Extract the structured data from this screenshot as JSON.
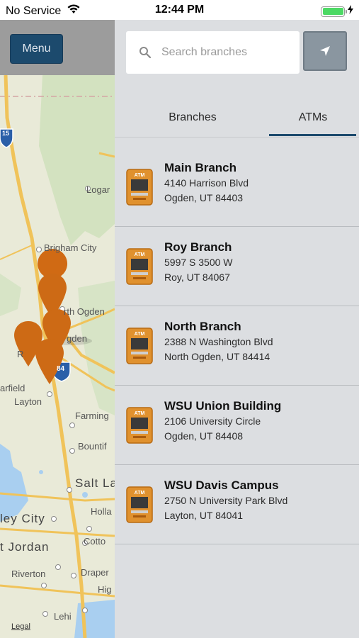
{
  "status_bar": {
    "carrier": "No Service",
    "time": "12:44 PM"
  },
  "map": {
    "menu_label": "Menu",
    "legal_label": "Legal",
    "labels": [
      "Logar",
      "Brigham City",
      "rth Ogden",
      "gden",
      "R",
      "arfield",
      "Layton",
      "Farming",
      "Bountif",
      "Salt La",
      "Holla",
      "ley City",
      "t Jordan",
      "Cotto",
      "Riverton",
      "Draper",
      "Hig",
      "Lehi"
    ],
    "highway_shields": [
      "15",
      "84"
    ],
    "pin_color": "#d06a14"
  },
  "search": {
    "placeholder": "Search branches"
  },
  "tabs": [
    {
      "label": "Branches",
      "selected": false
    },
    {
      "label": "ATMs",
      "selected": true
    }
  ],
  "locations": [
    {
      "name": "Main Branch",
      "street": "4140 Harrison Blvd",
      "city": "Ogden, UT 84403"
    },
    {
      "name": "Roy Branch",
      "street": "5997 S 3500 W",
      "city": "Roy, UT 84067"
    },
    {
      "name": "North Branch",
      "street": "2388 N Washington Blvd",
      "city": "North Ogden, UT 84414"
    },
    {
      "name": "WSU Union Building",
      "street": "2106 University Circle",
      "city": "Ogden, UT 84408"
    },
    {
      "name": "WSU Davis Campus",
      "street": "2750 N University Park Blvd",
      "city": "Layton, UT 84041"
    }
  ],
  "colors": {
    "menu_button": "#1c4a6d",
    "panel_bg": "#dcdee1",
    "tab_underline": "#1c4a6d",
    "atm_icon": "#e0912e"
  },
  "icons": {
    "atm": "atm-machine-icon",
    "locate": "location-arrow-icon",
    "search": "magnifier-icon"
  }
}
